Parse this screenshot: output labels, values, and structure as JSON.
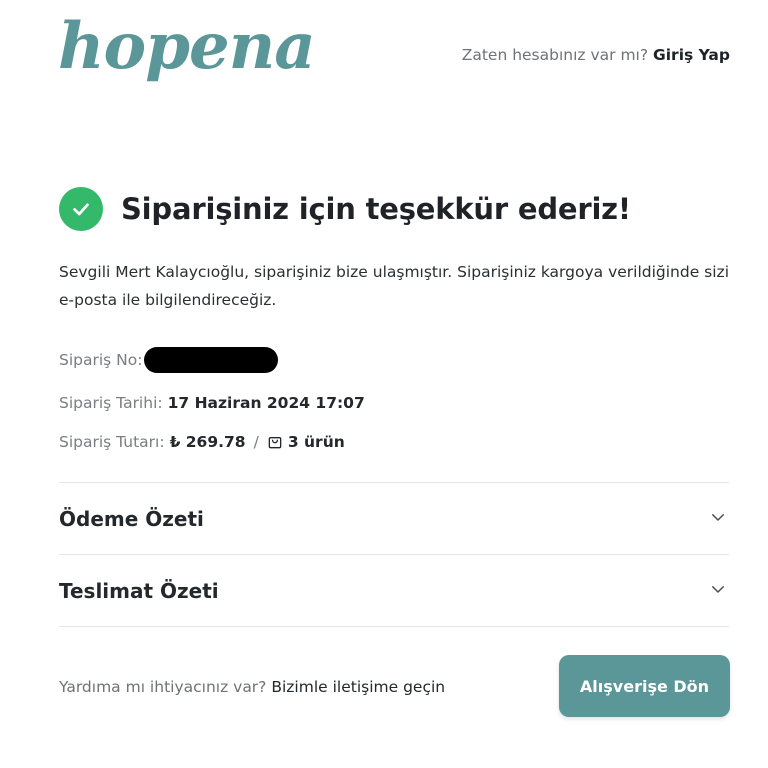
{
  "header": {
    "logo_text": "hopena",
    "login_prompt": "Zaten hesabınız var mı?",
    "login_link": "Giriş Yap"
  },
  "confirmation": {
    "title": "Siparişiniz için teşekkür ederiz!",
    "message": "Sevgili Mert Kalaycıoğlu, siparişiniz bize ulaşmıştır. Siparişiniz kargoya verildiğinde sizi e-posta ile bilgilendireceğiz."
  },
  "order": {
    "number_label": "Sipariş No:",
    "date_label": "Sipariş Tarihi:",
    "date_value": "17 Haziran 2024 17:07",
    "total_label": "Sipariş Tutarı:",
    "total_value": "₺ 269.78",
    "separator": "/",
    "items_count": "3 ürün"
  },
  "accordions": [
    {
      "title": "Ödeme Özeti"
    },
    {
      "title": "Teslimat Özeti"
    }
  ],
  "footer": {
    "help_prompt": "Yardıma mı ihtiyacınız var?",
    "help_link": "Bizimle iletişime geçin",
    "shop_button": "Alışverişe Dön"
  },
  "colors": {
    "brand_teal": "#5b9698",
    "success_green": "#34b86a"
  },
  "icons": {
    "title": "check-circle-icon",
    "items": "shopping-bag-icon",
    "accordion": "chevron-down-icon"
  }
}
